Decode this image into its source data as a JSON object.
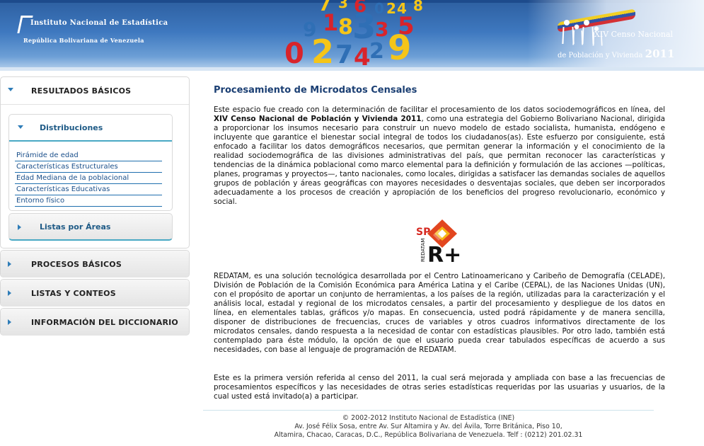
{
  "header": {
    "institute_name": "Instituto Nacional de Estadística",
    "country": "República Bolivariana de Venezuela",
    "census_logo": {
      "edition": "XIV",
      "title": "Censo Nacional",
      "subtitle": "de Población y Vivienda",
      "year": "2011"
    },
    "decorative_digits": [
      "7",
      "3",
      "6",
      "0",
      "2",
      "4",
      "8",
      "9",
      "1",
      "8",
      "3",
      "3",
      "5",
      "0",
      "2",
      "7",
      "4",
      "2",
      "9"
    ]
  },
  "sidebar": {
    "resultados": {
      "label": "RESULTADOS BÁSICOS",
      "distribuciones": {
        "label": "Distribuciones",
        "items": [
          "Pirámide de edad",
          "Características Estructurales",
          "Edad Mediana de la poblacional",
          "Características Educativas",
          "Entorno físico"
        ]
      },
      "listas_areas": {
        "label": "Listas por Áreas"
      }
    },
    "procesos": {
      "label": "PROCESOS BÁSICOS"
    },
    "listas": {
      "label": "LISTAS Y CONTEOS"
    },
    "diccionario": {
      "label": "INFORMACIÓN DEL DICCIONARIO"
    }
  },
  "main": {
    "title": "Procesamiento de Microdatos Censales",
    "p1_before": "Este espacio fue creado con la determinación de facilitar el procesamiento de los datos sociodemográficos en línea, del ",
    "p1_bold": "XIV Censo Nacional de Población y Vivienda 2011",
    "p1_after": ", como una estrategia del Gobierno Bolivariano Nacional, dirigida a proporcionar los insumos necesario para construir un nuevo modelo de estado socialista, humanista, endógeno e incluyente que garantice el bienestar social integral de todos los ciudadanos(as). Este esfuerzo por consiguiente, está enfocado a facilitar los datos demográficos necesarios, que permitan generar la información y el conocimiento de la realidad sociodemográfica de las divisiones administrativas del país, que permitan reconocer las características y tendencias de la dinámica poblacional como marco elemental para la definición y formulación de las acciones —políticas, planes, programas y proyectos—, tanto nacionales, como locales, dirigidas a satisfacer las demandas sociales de aquellos grupos de población y áreas geográficas con mayores necesidades o desventajas sociales, que deben ser incorporados adecuadamente a los procesos de creación y apropiación de los beneficios del progreso revolucionario, económico y social.",
    "logo": {
      "sp": "SP",
      "name": "REDATAM",
      "r": "R+"
    },
    "p2": "REDATAM, es una solución tecnológica desarrollada por el Centro Latinoamericano y Caribeño de Demografía (CELADE), División de Población de la Comisión Económica para América Latina y el Caribe (CEPAL), de las Naciones Unidas (UN), con el propósito de aportar un conjunto de herramientas, a los países de la región, utilizadas para la caracterización y el análisis local, estadal y regional de los microdatos censales, a partir del procesamiento y despliegue de los datos en línea, en elementales tablas, gráficos y/o mapas. En consecuencia, usted podrá rápidamente y de manera sencilla, disponer de distribuciones de frecuencias, cruces de variables y otros cuadros informativos directamente de los microdatos censales, dando respuesta a la necesidad de contar con estadísticas plausibles. Por otro lado, también está contemplado para éste módulo, la opción de que el usuario pueda crear tabulados específicas de acuerdo a sus necesidades, con base al lenguaje de programación de REDATAM.",
    "p3": "Este es la primera versión referida al censo del 2011, la cual será mejorada y ampliada con base a las frecuencias de procesamientos específicos y las necesidades de otras series estadísticas requeridas por las usuarias y usuarios, de la cual usted está invitado(a) a participar."
  },
  "footer": {
    "line1": "© 2002-2012 Instituto Nacional de Estadística (INE)",
    "line2": "Av. José Félix Sosa, entre Av. Sur Altamira y Av. del Ávila, Torre Británica, Piso 10,",
    "line3": "Altamira, Chacao, Caracas, D.C., República Bolivariana de Venezuela. Telf : (0212) 201.02.31"
  },
  "colors": {
    "banner": "#3e78bf",
    "link": "#1a4f8a",
    "title": "#1b3f73",
    "accent": "#2f7db8"
  }
}
